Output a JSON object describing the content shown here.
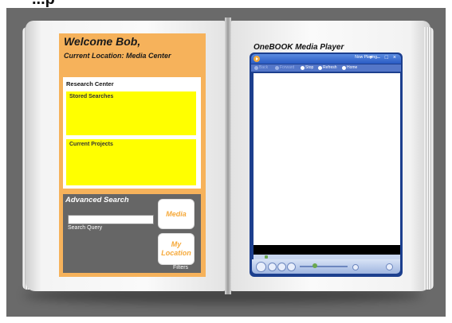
{
  "top_text": "...p",
  "welcome": {
    "title": "Welcome Bob,",
    "location": "Current Location: Media Center"
  },
  "research": {
    "title": "Research Center",
    "stored_searches": "Stored Searches",
    "current_projects": "Current Projects"
  },
  "advanced_search": {
    "title": "Advanced Search",
    "query_value": "",
    "query_label": "Search Query",
    "media_button": "Media",
    "location_button_line1": "My",
    "location_button_line2": "Location",
    "filters_label": "Filters"
  },
  "player": {
    "title": "OneBOOK Media Player",
    "now_playing": "Now Playing",
    "window_controls": "▾ – □ ×",
    "nav": [
      "Back",
      "Forward",
      "Stop",
      "Refresh",
      "Home"
    ]
  },
  "colors": {
    "welcome_panel": "#f6b25b",
    "yellow_boxes": "#ffff00",
    "search_panel": "#666666",
    "button_text": "#f6a93a",
    "player_frame": "#1c3f8e",
    "backdrop": "#6a6a6a"
  },
  "icons": [
    "media-player-logo-icon",
    "back-icon",
    "forward-icon",
    "stop-icon",
    "refresh-icon",
    "home-icon",
    "play-icon",
    "volume-slider-icon"
  ]
}
